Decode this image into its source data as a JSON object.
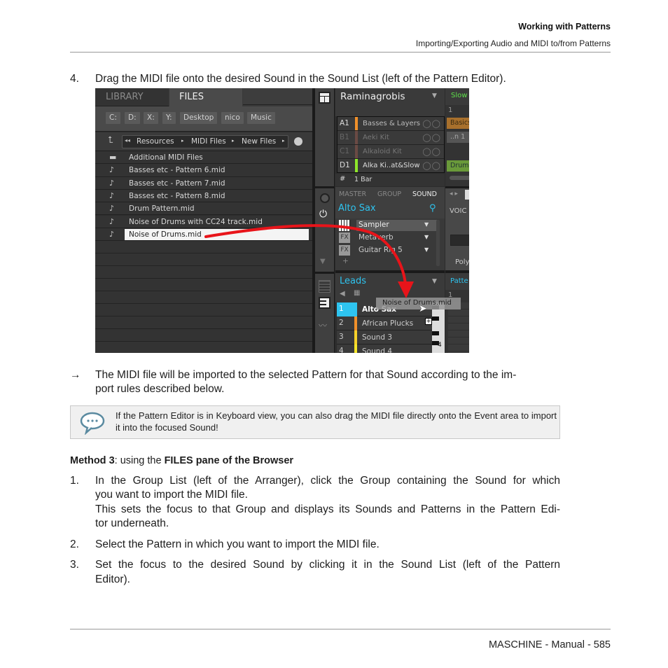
{
  "header": {
    "chapter": "Working with Patterns",
    "section": "Importing/Exporting Audio and MIDI to/from Patterns"
  },
  "step4": {
    "num": "4.",
    "text": "Drag the MIDI file onto the desired Sound in the Sound List (left of the Pattern Editor)."
  },
  "screenshot": {
    "browser": {
      "tabs": [
        "LIBRARY",
        "FILES"
      ],
      "active_tab": "FILES",
      "drives": [
        "C:",
        "D:",
        "X:",
        "Y:",
        "Desktop",
        "nico",
        "Music"
      ],
      "path": [
        "Resources",
        "MIDI Files",
        "New Files"
      ],
      "files": [
        {
          "name": "Additional MIDI Files",
          "icon": "folder-icon"
        },
        {
          "name": "Basses etc - Pattern 6.mid",
          "icon": "note-icon"
        },
        {
          "name": "Basses etc - Pattern 7.mid",
          "icon": "note-icon"
        },
        {
          "name": "Basses etc - Pattern 8.mid",
          "icon": "note-icon"
        },
        {
          "name": "Drum Pattern.mid",
          "icon": "note-icon"
        },
        {
          "name": "Noise of Drums with CC24 track.mid",
          "icon": "note-icon"
        },
        {
          "name": "Noise of Drums.mid",
          "icon": "note-icon",
          "selected": true
        }
      ]
    },
    "project": {
      "name": "Raminagrobis",
      "groups": [
        {
          "id": "A1",
          "name": "Basses & Layers",
          "color": "#f0902a",
          "dim": false
        },
        {
          "id": "B1",
          "name": "Aeki Kit",
          "color": "#6a4a44",
          "dim": true
        },
        {
          "id": "C1",
          "name": "Alkaloid Kit",
          "color": "#6a4a44",
          "dim": true
        },
        {
          "id": "D1",
          "name": "Alka Ki..at&Slow",
          "color": "#8ee62a",
          "dim": false
        }
      ],
      "bars": "1 Bar"
    },
    "sound_panel": {
      "tabs": [
        "MASTER",
        "GROUP",
        "SOUND"
      ],
      "active_tab": "SOUND",
      "sound_name": "Alto Sax",
      "plugins": [
        {
          "name": "Sampler",
          "type": "instrument"
        },
        {
          "name": "Metaverb",
          "type": "FX"
        },
        {
          "name": "Guitar Rig 5",
          "type": "FX"
        }
      ],
      "add_label": "+"
    },
    "sound_list": {
      "group_name": "Leads",
      "sounds": [
        {
          "id": "1",
          "name": "Alto Sax",
          "color": "#2ec4f0",
          "selected": true
        },
        {
          "id": "2",
          "name": "African Plucks",
          "color": "#f0902a"
        },
        {
          "id": "3",
          "name": "Sound 3",
          "color": "#f5d22a"
        },
        {
          "id": "4",
          "name": "Sound 4",
          "color": "#f5e62a"
        }
      ],
      "drag_label": "Noise of Drums.mid",
      "key_label": "4"
    },
    "right_edge": {
      "scene": "Slow",
      "ruler": "1",
      "clips": [
        "Basics",
        "..n 1",
        "",
        "Drum"
      ],
      "voice": "VOIC",
      "poly": "Poly",
      "pattern": "Patte",
      "pattern_ruler": "1"
    },
    "accent_colors": {
      "cyan": "#2ec4f0",
      "green": "#5ee04a",
      "arrow": "#e8141a"
    }
  },
  "result": {
    "arrow": "→",
    "text1": "The MIDI file will be imported to the selected Pattern for that Sound according to the im-",
    "text2": "port rules described below."
  },
  "tip": {
    "icon": "speech-bubble-icon",
    "text": "If the Pattern Editor is in Keyboard view, you can also drag the MIDI file directly onto the Event area to import it into the focused Sound!"
  },
  "method3": {
    "bold1": "Method 3",
    "mid": ": using the ",
    "bold2": "FILES pane of the Browser"
  },
  "steps": [
    {
      "num": "1.",
      "lines": [
        "In the Group List (left of the Arranger), click the Group containing the Sound for which",
        "you want to import the MIDI file.",
        "This sets the focus to that Group and displays its Sounds and Patterns in the Pattern Edi-",
        "tor underneath."
      ]
    },
    {
      "num": "2.",
      "lines": [
        "Select the Pattern in which you want to import the MIDI file."
      ]
    },
    {
      "num": "3.",
      "lines": [
        "Set the focus to the desired Sound by clicking it in the Sound List (left of the Pattern",
        "Editor)."
      ]
    }
  ],
  "footer": {
    "text": "MASCHINE - Manual - 585"
  }
}
